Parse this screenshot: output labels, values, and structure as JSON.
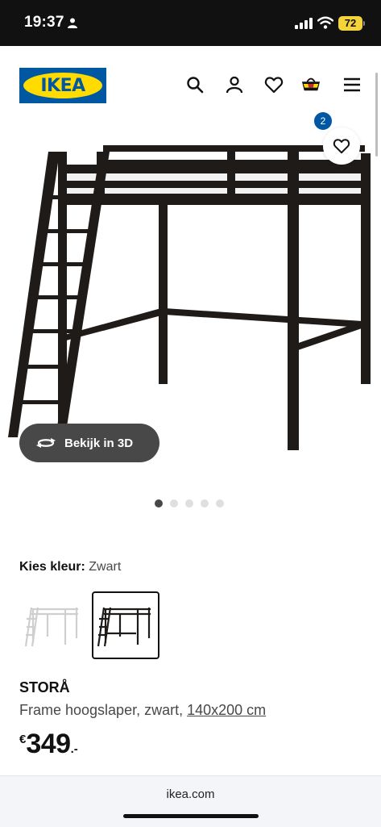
{
  "status_bar": {
    "time": "19:37",
    "battery": "72"
  },
  "header": {
    "logo_text": "IKEA",
    "cart_count": "2",
    "icons": [
      "search-icon",
      "profile-icon",
      "heart-icon",
      "basket-icon",
      "hamburger-menu-icon"
    ]
  },
  "gallery": {
    "view_3d_label": "Bekijk in 3D",
    "slide_count": 5,
    "active_slide": 1
  },
  "colour": {
    "label": "Kies kleur:",
    "selected": "Zwart",
    "options": [
      "white",
      "black"
    ]
  },
  "product": {
    "name": "STORÅ",
    "description": "Frame hoogslaper, zwart, ",
    "size": "140x200 cm",
    "price_currency": "€",
    "price_amount": "349",
    "price_cents": ".-"
  },
  "browser": {
    "url": "ikea.com"
  },
  "colors": {
    "ikea_blue": "#0058a3",
    "ikea_yellow": "#ffdb00",
    "bed_frame": "#1f1b19",
    "button_dark": "#484848"
  }
}
